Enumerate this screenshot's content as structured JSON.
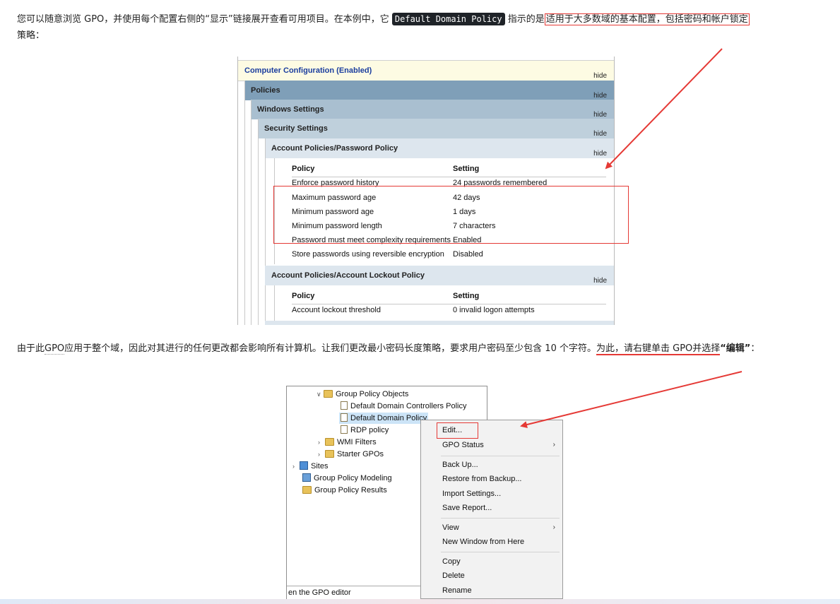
{
  "article": {
    "p1_before": "您可以随意浏览 GPO，并使用每个配置右侧的“显示”链接展开查看可用项目。在本例中，它",
    "p1_code": "Default Domain Policy",
    "p1_mid": "指示的是",
    "p1_highlight": "适用于大多数域的基本配置，包括密码和帐户锁定",
    "p1_end": "策略：",
    "p2_a": "由于此",
    "p2_gpo": "GPO",
    "p2_b": "应用于整个域，因此对其进行的任何更改都会影响所有计算机。让我们更改最小密码长度策略，要求用户密码至少包含 10 个字符。",
    "p2_highlight": "为此，请右键单击 GPO并选择",
    "p2_bold": "“编辑”",
    "p2_end": "："
  },
  "report": {
    "computer_config": "Computer Configuration (Enabled)",
    "hide": "hide",
    "policies": "Policies",
    "windows_settings": "Windows Settings",
    "security_settings": "Security Settings",
    "password_policy": "Account Policies/Password Policy",
    "lockout_policy": "Account Policies/Account Lockout Policy",
    "col_policy": "Policy",
    "col_setting": "Setting",
    "password_rows": [
      {
        "policy": "Enforce password history",
        "setting": "24 passwords remembered"
      },
      {
        "policy": "Maximum password age",
        "setting": "42 days"
      },
      {
        "policy": "Minimum password age",
        "setting": "1 days"
      },
      {
        "policy": "Minimum password length",
        "setting": "7 characters"
      },
      {
        "policy": "Password must meet complexity requirements",
        "setting": "Enabled"
      },
      {
        "policy": "Store passwords using reversible encryption",
        "setting": "Disabled"
      }
    ],
    "lockout_rows": [
      {
        "policy": "Account lockout threshold",
        "setting": "0 invalid logon attempts"
      }
    ]
  },
  "tree": {
    "group_policy_objects": "Group Policy Objects",
    "ddc_policy": "Default Domain Controllers Policy",
    "dd_policy": "Default Domain Policy",
    "rdp_policy": "RDP policy",
    "wmi_filters": "WMI Filters",
    "starter_gpos": "Starter GPOs",
    "sites": "Sites",
    "modeling": "Group Policy Modeling",
    "results": "Group Policy Results",
    "status": "en the GPO editor"
  },
  "context_menu": {
    "edit": "Edit...",
    "gpo_status": "GPO Status",
    "back_up": "Back Up...",
    "restore": "Restore from Backup...",
    "import": "Import Settings...",
    "save_report": "Save Report...",
    "view": "View",
    "new_window": "New Window from Here",
    "copy": "Copy",
    "delete": "Delete",
    "rename": "Rename"
  },
  "colors": {
    "annotation_red": "#e53935",
    "code_bg": "#1f2328"
  }
}
